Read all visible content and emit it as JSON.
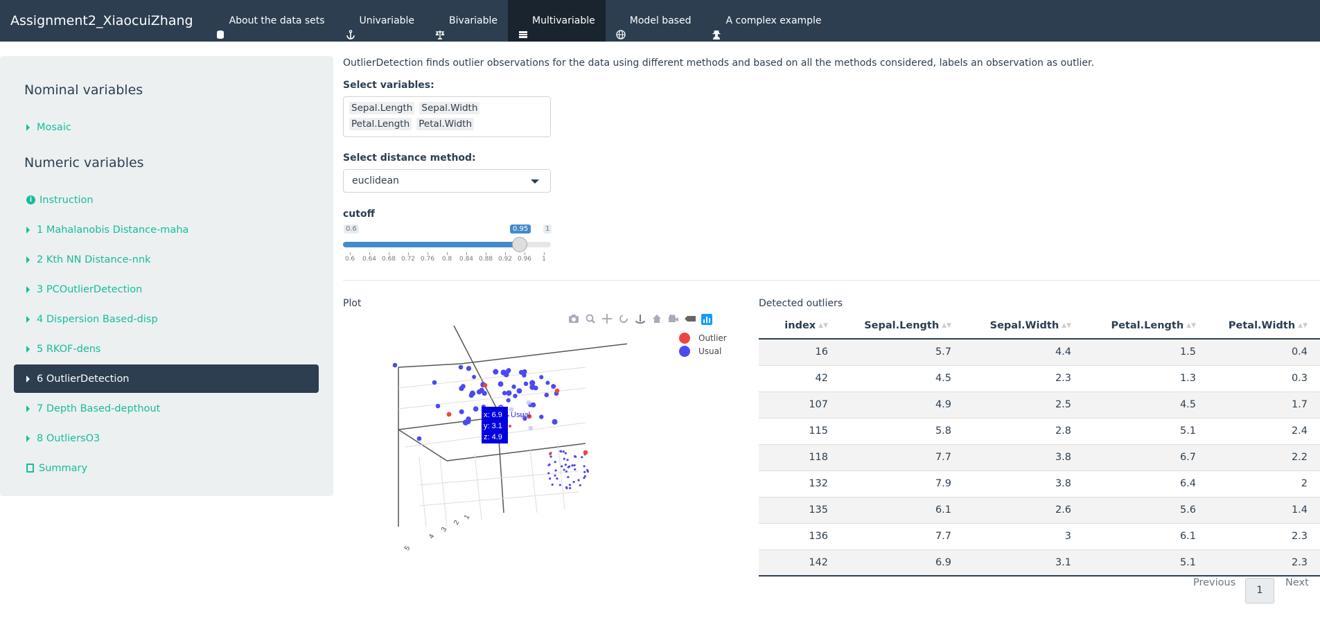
{
  "navbar": {
    "brand": "Assignment2_XiaocuiZhang",
    "items": [
      {
        "label": "About the data sets",
        "icon": "database-icon",
        "active": false
      },
      {
        "label": "Univariable",
        "icon": "anchor-icon",
        "active": false
      },
      {
        "label": "Bivariable",
        "icon": "balance-scale-icon",
        "active": false
      },
      {
        "label": "Multivariable",
        "icon": "table-icon",
        "active": true
      },
      {
        "label": "Model based",
        "icon": "globe-icon",
        "active": false
      },
      {
        "label": "A complex example",
        "icon": "user-secret-icon",
        "active": false
      }
    ]
  },
  "sidebar": {
    "nominal_heading": "Nominal variables",
    "numeric_heading": "Numeric variables",
    "items": [
      {
        "label": "Mosaic"
      },
      {
        "label": "Instruction"
      },
      {
        "label": "1 Mahalanobis Distance-maha"
      },
      {
        "label": "2 Kth NN Distance-nnk"
      },
      {
        "label": "3 PCOutlierDetection"
      },
      {
        "label": "4 Dispersion Based-disp"
      },
      {
        "label": "5 RKOF-dens"
      },
      {
        "label": "6 OutlierDetection"
      },
      {
        "label": "7 Depth Based-depthout"
      },
      {
        "label": "8 OutliersO3"
      },
      {
        "label": "Summary"
      }
    ]
  },
  "main": {
    "description": "OutlierDetection finds outlier observations for the data using different methods and based on all the methods considered, labels an observation as outlier.",
    "select_variables_label": "Select variables:",
    "selected_variables": [
      "Sepal.Length",
      "Sepal.Width",
      "Petal.Length",
      "Petal.Width"
    ],
    "distance_label": "Select distance method:",
    "distance_value": "euclidean",
    "cutoff_label": "cutoff",
    "cutoff": {
      "min": "0.6",
      "max": "1",
      "value": "0.95",
      "ticks": [
        "0.6",
        "0.64",
        "0.68",
        "0.72",
        "0.76",
        "0.8",
        "0.84",
        "0.88",
        "0.92",
        "0.96",
        "1"
      ]
    },
    "plot_title": "Plot",
    "table_title": "Detected outliers"
  },
  "plot": {
    "legend": [
      {
        "label": "Outlier",
        "color": "#ef4444"
      },
      {
        "label": "Usual",
        "color": "#4a4af0"
      }
    ],
    "hover": {
      "x": "x: 6.9",
      "y": "y: 3.1",
      "z": "z: 4.9",
      "trace": "Usual"
    },
    "axis_ticks": [
      "5",
      "4",
      "3",
      "2",
      "1"
    ]
  },
  "table": {
    "columns": [
      "index",
      "Sepal.Length",
      "Sepal.Width",
      "Petal.Length",
      "Petal.Width"
    ],
    "rows": [
      [
        "16",
        "5.7",
        "4.4",
        "1.5",
        "0.4"
      ],
      [
        "42",
        "4.5",
        "2.3",
        "1.3",
        "0.3"
      ],
      [
        "107",
        "4.9",
        "2.5",
        "4.5",
        "1.7"
      ],
      [
        "115",
        "5.8",
        "2.8",
        "5.1",
        "2.4"
      ],
      [
        "118",
        "7.7",
        "3.8",
        "6.7",
        "2.2"
      ],
      [
        "132",
        "7.9",
        "3.8",
        "6.4",
        "2"
      ],
      [
        "135",
        "6.1",
        "2.6",
        "5.6",
        "1.4"
      ],
      [
        "136",
        "7.7",
        "3",
        "6.1",
        "2.3"
      ],
      [
        "142",
        "6.9",
        "3.1",
        "5.1",
        "2.3"
      ]
    ]
  },
  "pager": {
    "previous": "Previous",
    "current": "1",
    "next": "Next"
  }
}
